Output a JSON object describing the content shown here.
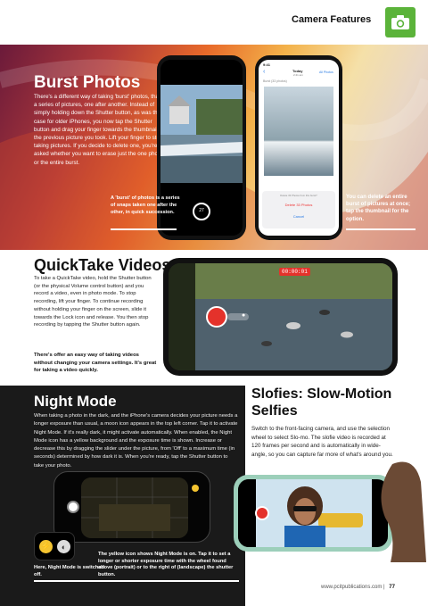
{
  "header": {
    "section": "Camera Features",
    "badge_icon": "camera-icon"
  },
  "burst": {
    "title": "Burst Photos",
    "body": "There's a different way of taking 'burst' photos, that is, a series of pictures, one after another. Instead of simply holding down the Shutter button, as was the case for older iPhones, you now tap the Shutter button and drag your finger towards the thumbnail of the previous picture you took. Lift your finger to stop taking pictures. If you decide to delete one, you're asked whether you want to erase just the one photo or the entire burst.",
    "caption_left": "A 'burst' of photos is a series of snaps taken one after the other, in quick succession.",
    "caption_right": "You can delete an entire burst of pictures at once; tap the thumbnail for the option.",
    "phone1_counter": "27",
    "phone2": {
      "time": "9:41",
      "title": "Today",
      "subtitle": "2:41 am",
      "action": "All Photos",
      "info": "Burst (33 photos)",
      "delete_prompt": "Delete 33 Photos from this burst?",
      "delete_button": "Delete 33 Photos",
      "cancel": "Cancel"
    }
  },
  "quicktake": {
    "title": "QuickTake Videos",
    "body": "To take a QuickTake video, hold the Shutter button (or the physical Volume control button) and you record a video, even in photo mode. To stop recording, lift your finger. To continue recording without holding your finger on the screen, slide it towards the Lock icon and release. You then stop recording by tapping the Shutter button again.",
    "note": "There's offer an easy way of taking videos without changing your camera settings. It's great for taking a video quickly.",
    "timer": "00:00:01"
  },
  "night": {
    "title": "Night Mode",
    "body": "When taking a photo in the dark, and the iPhone's camera decides your picture needs a longer exposure than usual, a moon icon appears in the top left corner. Tap it to activate Night Mode. If it's really dark, it might activate automatically. When enabled, the Night Mode icon has a yellow background and the exposure time is shown. Increase or decrease this by dragging the slider under the picture, from 'Off' to a maximum time (in seconds) determined by how dark it is. When you're ready, tap the Shutter button to take your photo.",
    "caption_left": "Here, Night Mode is switched off.",
    "caption_right": "The yellow icon shows Night Mode is on. Tap it to set a longer or shorter exposure time with the wheel found above (portrait) or to the right of (landscape) the shutter button."
  },
  "slofies": {
    "title": "Slofies: Slow-Motion Selfies",
    "body": "Switch to the front-facing camera, and use the selection wheel to select Slo-mo. The slofie video is recorded at 120 frames per second and is automatically in wide-angle, so you can capture far more of what's around you."
  },
  "footer": {
    "site": "www.pcitpublications.com",
    "page": "77"
  }
}
